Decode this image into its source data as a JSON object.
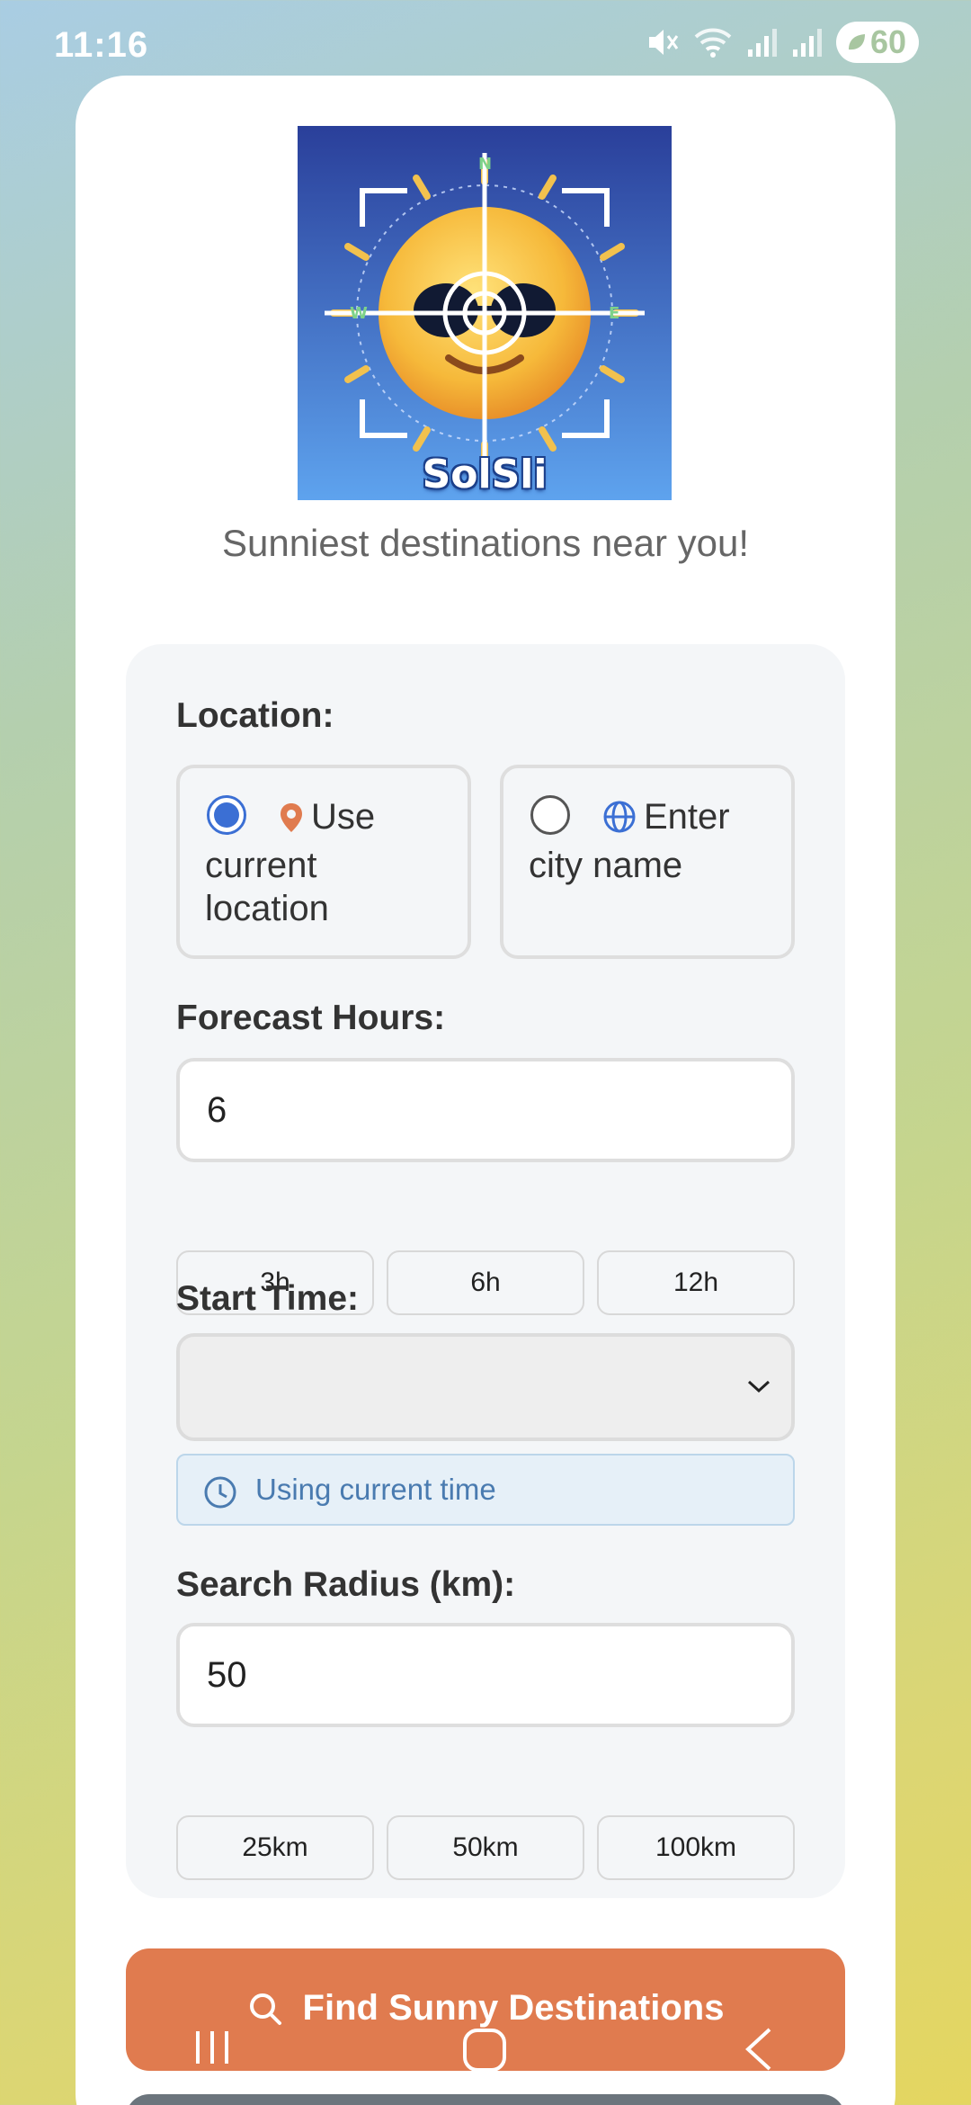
{
  "status_bar": {
    "time": "11:16",
    "battery": "60"
  },
  "app": {
    "logo_text": "SolSli",
    "tagline": "Sunniest destinations near you!"
  },
  "location": {
    "label": "Location:",
    "options": [
      {
        "label": "Use current location",
        "selected": true,
        "icon": "map-pin-icon"
      },
      {
        "label": "Enter city name",
        "selected": false,
        "icon": "globe-icon"
      }
    ]
  },
  "forecast": {
    "label": "Forecast Hours:",
    "value": "6",
    "presets": [
      "3h",
      "6h",
      "12h"
    ]
  },
  "start_time": {
    "label": "Start Time:",
    "selected": "",
    "info": "Using current time"
  },
  "radius": {
    "label": "Search Radius (km):",
    "value": "50",
    "presets": [
      "25km",
      "50km",
      "100km"
    ]
  },
  "actions": {
    "find_label": "Find Sunny Destinations"
  },
  "colors": {
    "accent": "#e07b4f",
    "radio_selected": "#3b6fd4",
    "info_text": "#4a7bb0",
    "secondary": "#6c757d"
  }
}
